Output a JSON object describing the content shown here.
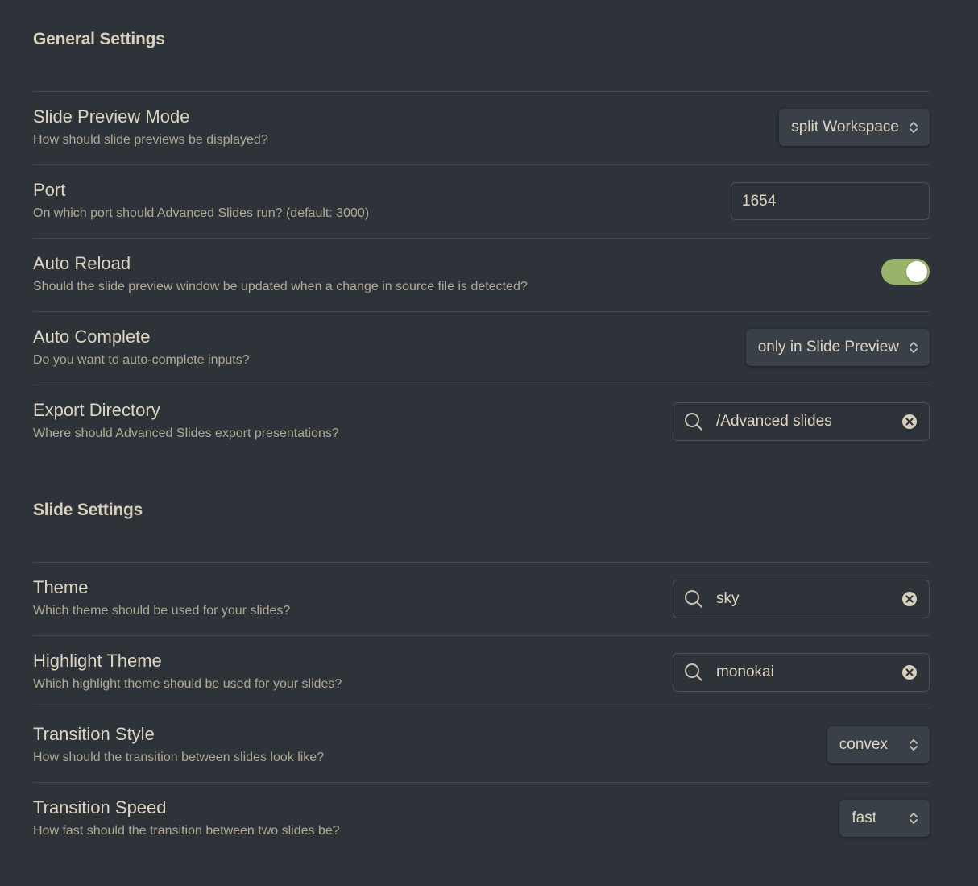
{
  "general": {
    "heading": "General Settings",
    "slide_preview_mode": {
      "name": "Slide Preview Mode",
      "desc": "How should slide previews be displayed?",
      "value": "split Workspace"
    },
    "port": {
      "name": "Port",
      "desc": "On which port should Advanced Slides run? (default: 3000)",
      "value": "1654"
    },
    "auto_reload": {
      "name": "Auto Reload",
      "desc": "Should the slide preview window be updated when a change in source file is detected?",
      "enabled": true
    },
    "auto_complete": {
      "name": "Auto Complete",
      "desc": "Do you want to auto-complete inputs?",
      "value": "only in Slide Preview"
    },
    "export_directory": {
      "name": "Export Directory",
      "desc": "Where should Advanced Slides export presentations?",
      "value": "/Advanced slides"
    }
  },
  "slide": {
    "heading": "Slide Settings",
    "theme": {
      "name": "Theme",
      "desc": "Which theme should be used for your slides?",
      "value": "sky"
    },
    "highlight_theme": {
      "name": "Highlight Theme",
      "desc": "Which highlight theme should be used for your slides?",
      "value": "monokai"
    },
    "transition_style": {
      "name": "Transition Style",
      "desc": "How should the transition between slides look like?",
      "value": "convex"
    },
    "transition_speed": {
      "name": "Transition Speed",
      "desc": "How fast should the transition between two slides be?",
      "value": "fast"
    }
  },
  "icons": {
    "search": "search-icon",
    "clear": "clear-icon",
    "chevron": "chevron-up-down-icon"
  },
  "colors": {
    "background": "#2e3339",
    "toggle_on": "#99b36a",
    "text": "#ddd5c2",
    "muted_text": "#b0a995"
  }
}
